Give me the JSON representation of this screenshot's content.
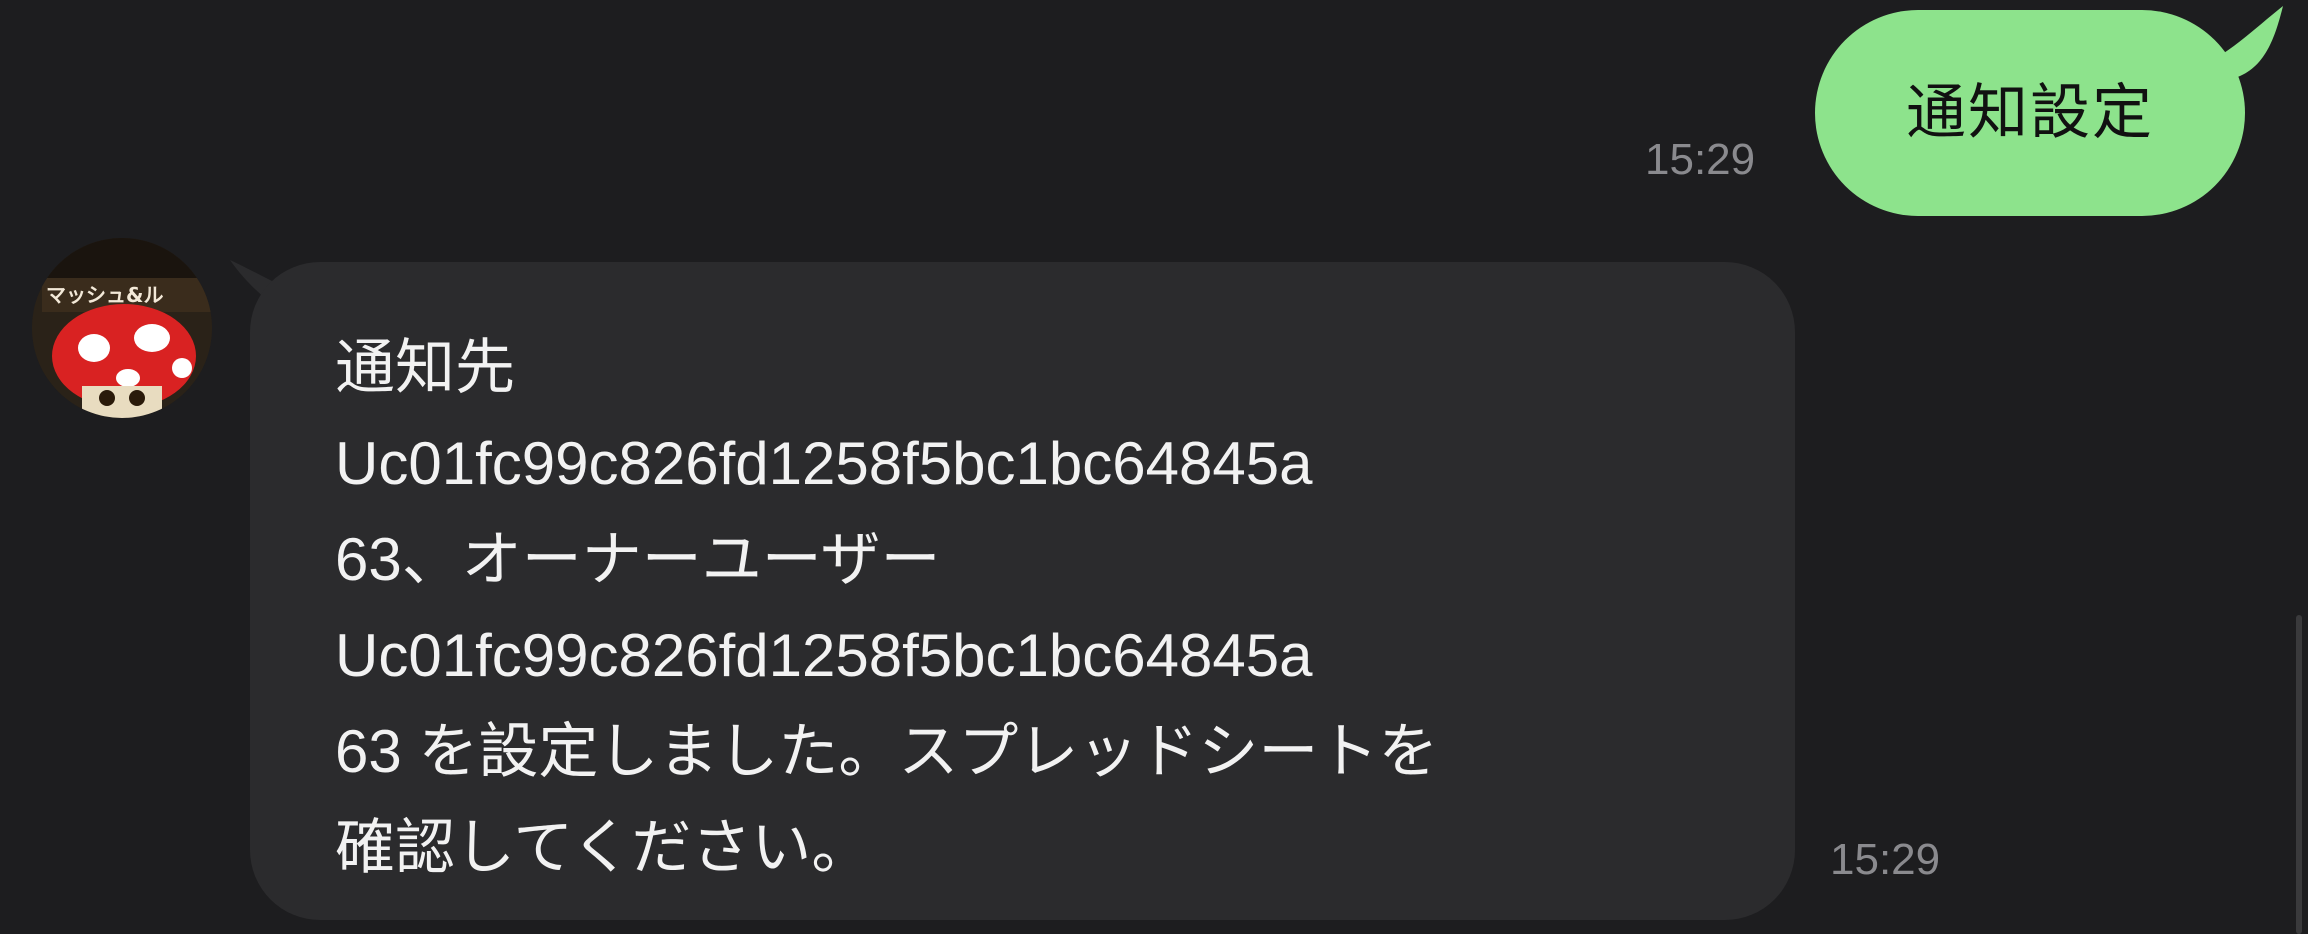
{
  "outgoing": {
    "text": "通知設定",
    "time": "15:29",
    "bubble_color": "#8de38c"
  },
  "incoming": {
    "avatar_label": "マッシュ&ル",
    "lines": [
      "通知先",
      "Uc01fc99c826fd1258f5bc1bc64845a",
      "63、オーナーユーザー",
      "Uc01fc99c826fd1258f5bc1bc64845a",
      "63 を設定しました。スプレッドシートを",
      "確認してください。"
    ],
    "time": "15:29",
    "bubble_color": "#2b2b2d"
  },
  "colors": {
    "background": "#1d1d1f",
    "timestamp": "#8a8a8e"
  }
}
